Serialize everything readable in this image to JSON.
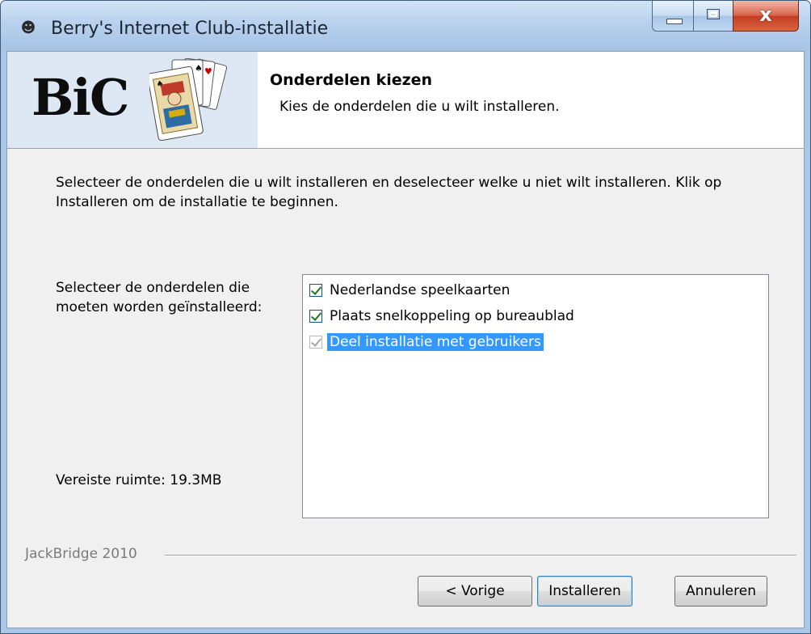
{
  "window": {
    "title": "Berry's Internet Club-installatie",
    "icon": "face-app-icon",
    "controls": {
      "minimize": "minimize-icon",
      "maximize": "maximize-icon",
      "close_glyph": "x"
    }
  },
  "header": {
    "logo_text": "BiC",
    "title": "Onderdelen kiezen",
    "subtitle": "Kies de onderdelen die u wilt installeren."
  },
  "body": {
    "intro": "Selecteer de onderdelen die u wilt installeren en deselecteer welke u niet wilt installeren. Klik op Installeren om de installatie te beginnen.",
    "prompt": "Selecteer de onderdelen die moeten worden geïnstalleerd:",
    "space_required": "Vereiste ruimte: 19.3MB"
  },
  "components": [
    {
      "label": "Nederlandse speelkaarten",
      "checked": true,
      "disabled": false,
      "selected": false
    },
    {
      "label": "Plaats snelkoppeling op bureaublad",
      "checked": true,
      "disabled": false,
      "selected": false
    },
    {
      "label": "Deel installatie met gebruikers",
      "checked": true,
      "disabled": true,
      "selected": true
    }
  ],
  "footer": {
    "brand": "JackBridge 2010",
    "back_label": "< Vorige",
    "install_label": "Installeren",
    "cancel_label": "Annuleren"
  },
  "colors": {
    "selection": "#3399ff",
    "checkmark": "#1f7a1f",
    "close_button": "#c43d22"
  }
}
